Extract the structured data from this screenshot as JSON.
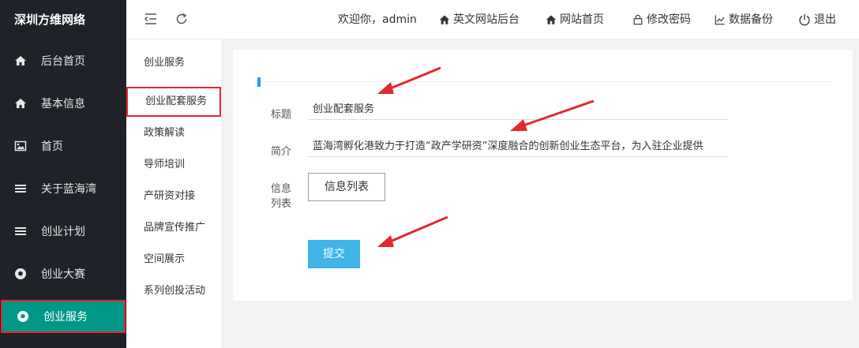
{
  "app": {
    "brand": "深圳方维网络"
  },
  "sidebar": {
    "items": [
      {
        "label": "后台首页",
        "icon": "home-icon"
      },
      {
        "label": "基本信息",
        "icon": "home-icon"
      },
      {
        "label": "首页",
        "icon": "image-icon"
      },
      {
        "label": "关于蓝海湾",
        "icon": "menu-icon"
      },
      {
        "label": "创业计划",
        "icon": "menu-icon"
      },
      {
        "label": "创业大赛",
        "icon": "soccer-icon"
      },
      {
        "label": "创业服务",
        "icon": "soccer-icon",
        "active": true
      }
    ]
  },
  "topbar": {
    "welcome": "欢迎你，admin",
    "links": [
      {
        "label": "英文网站后台",
        "icon": "home-icon"
      },
      {
        "label": "网站首页",
        "icon": "home-icon"
      },
      {
        "label": "修改密码",
        "icon": "lock-icon"
      },
      {
        "label": "数据备份",
        "icon": "chart-icon"
      },
      {
        "label": "退出",
        "icon": "power-icon"
      }
    ]
  },
  "subnav": {
    "items": [
      {
        "label": "创业服务"
      },
      {
        "label": "创业配套服务",
        "active": true
      },
      {
        "label": "政策解读"
      },
      {
        "label": "导师培训"
      },
      {
        "label": "产研资对接"
      },
      {
        "label": "品牌宣传推广"
      },
      {
        "label": "空间展示"
      },
      {
        "label": "系列创投活动"
      }
    ]
  },
  "form": {
    "title_label": "标题",
    "title_value": "创业配套服务",
    "intro_label": "简介",
    "intro_value": "蓝海湾孵化港致力于打造“政产学研资”深度融合的创新创业生态平台，为入驻企业提供",
    "list_label_1": "信息",
    "list_label_2": "列表",
    "list_button": "信息列表",
    "submit_button": "提交"
  },
  "colors": {
    "sidebar_bg": "#20222a",
    "active_bg": "#009688",
    "highlight": "#e4282c",
    "submit_bg": "#3eb4e8",
    "accent": "#1e9fff"
  }
}
